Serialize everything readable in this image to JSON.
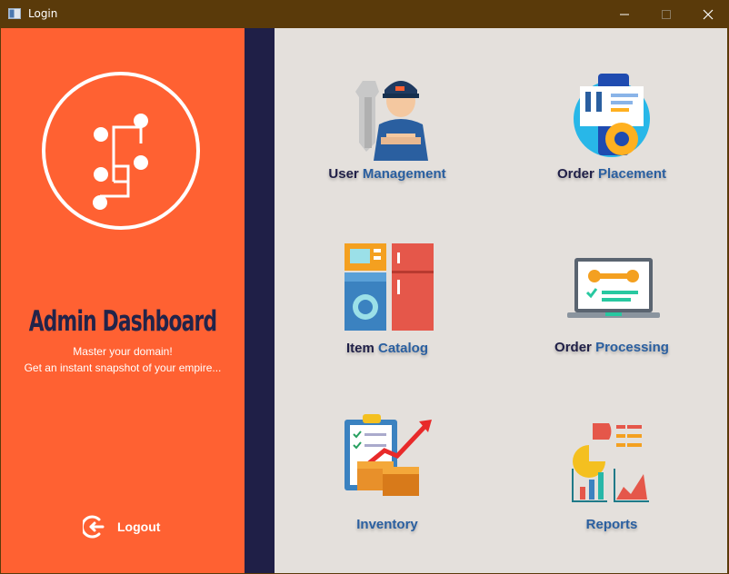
{
  "window": {
    "title": "Login",
    "controls": [
      "minimize",
      "maximize",
      "close"
    ]
  },
  "sidebar": {
    "logo_icon": "circuit-s-logo-icon",
    "title": "Admin Dashboard",
    "tagline_line1": "Master your domain!",
    "tagline_line2": "Get an instant snapshot of your empire...",
    "logout_label": "Logout",
    "logout_icon": "logout-icon"
  },
  "tiles": [
    {
      "id": "user-management",
      "label_part1": "User ",
      "label_part2": "Management",
      "icon": "mechanic-worker-icon"
    },
    {
      "id": "order-placement",
      "label_part1": "Order ",
      "label_part2": "Placement",
      "icon": "phone-tools-gear-icon"
    },
    {
      "id": "item-catalog",
      "label_part1": "Item ",
      "label_part2": "Catalog",
      "icon": "appliances-icon"
    },
    {
      "id": "order-processing",
      "label_part1": "Order ",
      "label_part2": "Processing",
      "icon": "laptop-wrench-icon"
    },
    {
      "id": "inventory",
      "label_part1": "",
      "label_part2": "Inventory",
      "icon": "clipboard-boxes-icon"
    },
    {
      "id": "reports",
      "label_part1": "",
      "label_part2": "Reports",
      "icon": "charts-report-icon"
    }
  ],
  "colors": {
    "titlebar": "#5a3a0a",
    "sidebar": "#ff6132",
    "strip": "#1f1f47",
    "main_bg": "#e4e0dc",
    "label_dark": "#1f1f47",
    "label_blue": "#2a5fa0"
  }
}
